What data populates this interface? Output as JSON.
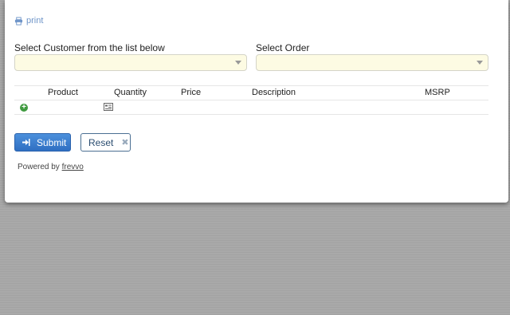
{
  "print": {
    "label": "print",
    "icon": "printer-icon"
  },
  "customer": {
    "label": "Select Customer from the list below",
    "value": ""
  },
  "order": {
    "label": "Select Order",
    "value": ""
  },
  "table": {
    "columns": [
      "Product",
      "Quantity",
      "Price",
      "Description",
      "MSRP"
    ],
    "add_row_icon": "plus-circle-icon",
    "detail_icon": "id-card-icon"
  },
  "buttons": {
    "submit_label": "Submit",
    "submit_icon": "sign-in-icon",
    "reset_label": "Reset",
    "reset_icon": "close-icon"
  },
  "footer": {
    "powered_text": "Powered by",
    "powered_link": "frevvo"
  },
  "colors": {
    "accent": "#6f95c9",
    "submit_bg": "#3a7fd1",
    "field_bg": "#fdfbe3",
    "add_icon": "#3f9a3f",
    "backdrop": "#a9a9a9"
  }
}
